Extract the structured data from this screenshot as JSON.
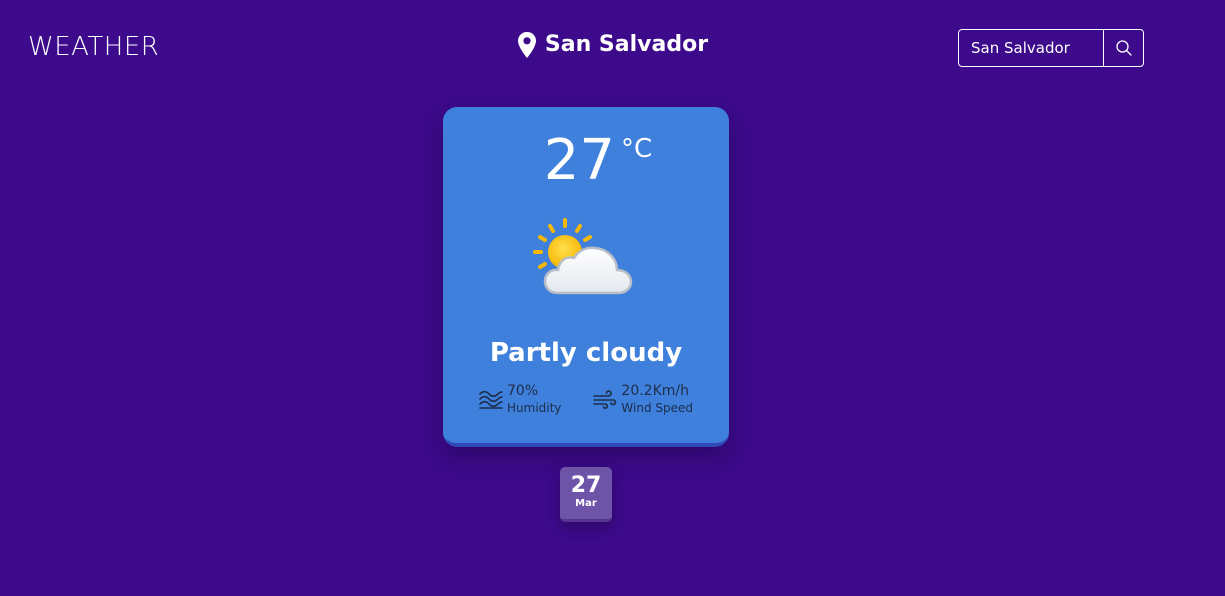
{
  "header": {
    "brand": "WEATHER",
    "location": "San Salvador",
    "location_icon": "map-pin-icon"
  },
  "search": {
    "value": "San Salvador",
    "icon": "search-icon"
  },
  "weather": {
    "temperature": "27",
    "unit": "°C",
    "icon": "partly-cloudy-icon",
    "condition": "Partly cloudy",
    "humidity": {
      "value": "70%",
      "label": "Humidity",
      "icon": "humidity-waves-icon"
    },
    "wind": {
      "value": "20.2Km/h",
      "label": "Wind Speed",
      "icon": "wind-icon"
    }
  },
  "forecast": [
    {
      "day": "27",
      "month": "Mar"
    }
  ],
  "colors": {
    "background": "#3c0a8b",
    "card": "#3e80dc",
    "date_badge": "#6e54a8"
  }
}
